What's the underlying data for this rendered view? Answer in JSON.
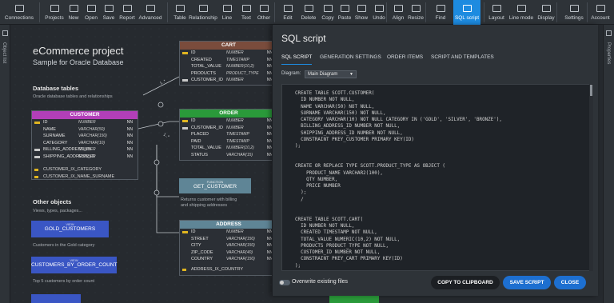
{
  "toolbar": {
    "items": [
      {
        "label": "Connections",
        "icon": "connections-icon"
      },
      {
        "label": "Projects",
        "icon": "projects-icon"
      },
      {
        "label": "New",
        "icon": "new-icon"
      },
      {
        "label": "Open",
        "icon": "open-icon"
      },
      {
        "label": "Save",
        "icon": "save-icon"
      },
      {
        "label": "Report",
        "icon": "report-icon"
      },
      {
        "label": "Advanced",
        "icon": "advanced-icon"
      },
      {
        "label": "Table",
        "icon": "table-icon"
      },
      {
        "label": "Relationship",
        "icon": "relationship-icon"
      },
      {
        "label": "Line",
        "icon": "line-icon"
      },
      {
        "label": "Text",
        "icon": "text-icon"
      },
      {
        "label": "Other",
        "icon": "other-icon"
      },
      {
        "label": "Edit",
        "icon": "edit-icon"
      },
      {
        "label": "Delete",
        "icon": "delete-icon"
      },
      {
        "label": "Copy",
        "icon": "copy-icon"
      },
      {
        "label": "Paste",
        "icon": "paste-icon"
      },
      {
        "label": "Show",
        "icon": "show-icon"
      },
      {
        "label": "Undo",
        "icon": "undo-icon"
      },
      {
        "label": "Align",
        "icon": "align-icon"
      },
      {
        "label": "Resize",
        "icon": "resize-icon"
      },
      {
        "label": "Find",
        "icon": "find-icon"
      },
      {
        "label": "SQL script",
        "icon": "sql-script-icon",
        "active": true
      },
      {
        "label": "Layout",
        "icon": "layout-icon"
      },
      {
        "label": "Line mode",
        "icon": "line-mode-icon"
      },
      {
        "label": "Display",
        "icon": "display-icon"
      },
      {
        "label": "Settings",
        "icon": "settings-icon"
      },
      {
        "label": "Account",
        "icon": "account-icon"
      }
    ],
    "accent": "#1d8be0"
  },
  "side": {
    "left": "Object list",
    "right": "Properties"
  },
  "diagram": {
    "title": "eCommerce project",
    "subtitle": "Sample for Oracle Database",
    "db_heading": "Database tables",
    "db_sub": "Oracle database tables and relationships",
    "other_heading": "Other objects",
    "other_sub": "Views, types, packages...",
    "cardinality_a": "1..*",
    "cardinality_b": "1..*",
    "customer": {
      "name": "CUSTOMER",
      "color": "#b23fb8",
      "rows": [
        {
          "n": "ID",
          "t": "NUMBER",
          "nn": "NN",
          "k": "pk"
        },
        {
          "n": "NAME",
          "t": "VARCHAR(50)",
          "nn": "NN",
          "k": ""
        },
        {
          "n": "SURNAME",
          "t": "VARCHAR(150)",
          "nn": "NN",
          "k": ""
        },
        {
          "n": "CATEGORY",
          "t": "VARCHAR(10)",
          "nn": "NN",
          "k": ""
        },
        {
          "n": "BILLING_ADDRESS_ID",
          "t": "NUMBER",
          "nn": "NN",
          "k": "fk"
        },
        {
          "n": "SHIPPING_ADDRESS_ID",
          "t": "NUMBER",
          "nn": "NN",
          "k": "fk"
        }
      ],
      "idx": [
        "CUSTOMER_IX_CATEGORY",
        "CUSTOMER_IX_NAME_SURNAME"
      ]
    },
    "cart": {
      "name": "CART",
      "color": "#7a4c3c",
      "rows": [
        {
          "n": "ID",
          "t": "NUMBER",
          "nn": "NN",
          "k": "pk"
        },
        {
          "n": "CREATED",
          "t": "TIMESTAMP",
          "nn": "NN",
          "k": ""
        },
        {
          "n": "TOTAL_VALUE",
          "t": "NUMBER(10,2)",
          "nn": "NN",
          "k": ""
        },
        {
          "n": "PRODUCTS",
          "t": "PRODUCT_TYPE",
          "nn": "NN",
          "k": ""
        },
        {
          "n": "CUSTOMER_ID",
          "t": "NUMBER",
          "nn": "NN",
          "k": "fk"
        }
      ]
    },
    "order": {
      "name": "ORDER",
      "color": "#2a9a3a",
      "rows": [
        {
          "n": "ID",
          "t": "NUMBER",
          "nn": "NN",
          "k": "pk"
        },
        {
          "n": "CUSTOMER_ID",
          "t": "NUMBER",
          "nn": "NN",
          "k": "fk"
        },
        {
          "n": "PLACED",
          "t": "TIMESTAMP",
          "nn": "NN",
          "k": ""
        },
        {
          "n": "PAID",
          "t": "TIMESTAMP",
          "nn": "NN",
          "k": ""
        },
        {
          "n": "TOTAL_VALUE",
          "t": "NUMBER(10,2)",
          "nn": "NN",
          "k": ""
        },
        {
          "n": "STATUS",
          "t": "VARCHAR(15)",
          "nn": "NN",
          "k": ""
        }
      ]
    },
    "address": {
      "name": "ADDRESS",
      "color": "#5f8596",
      "rows": [
        {
          "n": "ID",
          "t": "NUMBER",
          "nn": "NN",
          "k": "pk"
        },
        {
          "n": "STREET",
          "t": "VARCHAR(150)",
          "nn": "NN",
          "k": ""
        },
        {
          "n": "CITY",
          "t": "VARCHAR(150)",
          "nn": "NN",
          "k": ""
        },
        {
          "n": "ZIP_CODE",
          "t": "VARCHAR(40)",
          "nn": "NN",
          "k": ""
        },
        {
          "n": "COUNTRY",
          "t": "VARCHAR(150)",
          "nn": "NN",
          "k": ""
        }
      ],
      "idx": [
        "ADDRESS_IX_COUNTRY"
      ]
    },
    "get_customer": {
      "small": "FUNCTION",
      "name": "GET_CUSTOMER",
      "desc1": "Returns customer with billing",
      "desc2": "and shipping addresses"
    },
    "gold": {
      "small": "VIEW",
      "name": "GOLD_CUSTOMERS",
      "desc": "Customers in the Gold category"
    },
    "by_order": {
      "small": "VIEW",
      "name": "CUSTOMERS_BY_ORDER_COUNT",
      "desc": "Top 5 customers by order count"
    }
  },
  "panel": {
    "title": "SQL script",
    "tabs": [
      "SQL SCRIPT",
      "GENERATION SETTINGS",
      "ORDER ITEMS",
      "SCRIPT AND TEMPLATES"
    ],
    "diagram_label": "Diagram:",
    "diagram_value": "Main Diagram",
    "code": "CREATE TABLE SCOTT.CUSTOMER(\n  ID NUMBER NOT NULL,\n  NAME VARCHAR(50) NOT NULL,\n  SURNAME VARCHAR(150) NOT NULL,\n  CATEGORY VARCHAR(10) NOT NULL CATEGORY IN ('GOLD', 'SILVER', 'BRONZE'),\n  BILLING_ADDRESS_ID NUMBER NOT NULL,\n  SHIPPING_ADDRESS_ID NUMBER NOT NULL,\n  CONSTRAINT PKEY_CUSTOMER PRIMARY KEY(ID)\n);\n\n\nCREATE OR REPLACE TYPE SCOTT.PRODUCT_TYPE AS OBJECT (\n    PRODUCT_NAME VARCHAR2(100),\n    QTY NUMBER,\n    PRICE NUMBER\n  );\n  /\n\n\nCREATE TABLE SCOTT.CART(\n  ID NUMBER NOT NULL,\n  CREATED TIMESTAMP NOT NULL,\n  TOTAL_VALUE NUMERIC(10,2) NOT NULL,\n  PRODUCTS PRODUCT_TYPE NOT NULL,\n  CUSTOMER_ID NUMBER NOT NULL,\n  CONSTRAINT PKEY_CART PRIMARY KEY(ID)\n);",
    "overwrite_label": "Overwrite existing files",
    "copy_label": "COPY TO CLIPBOARD",
    "save_label": "SAVE SCRIPT",
    "close_label": "CLOSE"
  }
}
